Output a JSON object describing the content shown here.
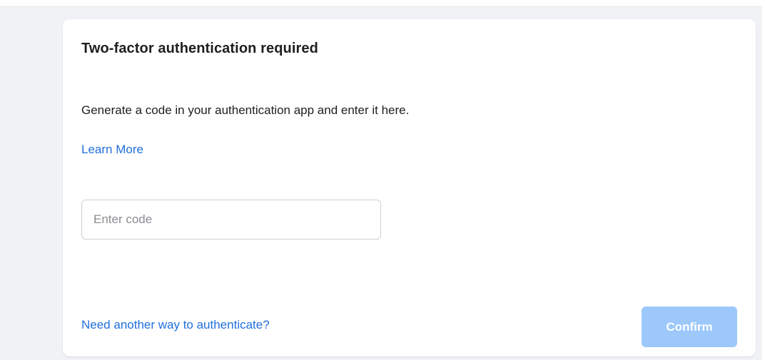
{
  "dialog": {
    "title": "Two-factor authentication required",
    "description": "Generate a code in your authentication app and enter it here.",
    "learn_more_label": "Learn More",
    "code_input": {
      "placeholder": "Enter code",
      "value": ""
    },
    "alt_auth_label": "Need another way to authenticate?",
    "confirm_label": "Confirm",
    "confirm_enabled": false
  },
  "colors": {
    "page_background": "#f0f2f5",
    "card_background": "#ffffff",
    "link": "#216fdb",
    "confirm_disabled_bg": "#9cc8fb",
    "text_primary": "#1c1e21",
    "placeholder": "#8a8d91"
  }
}
